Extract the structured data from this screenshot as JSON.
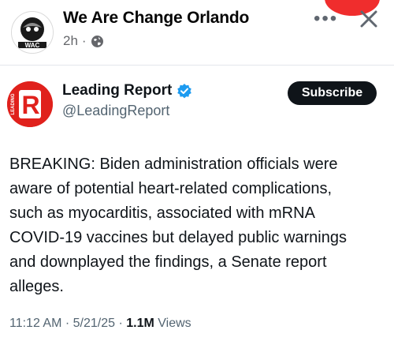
{
  "facebook_post": {
    "page_name": "We Are Change Orlando",
    "time_ago": "2h",
    "separator": "·",
    "more_icon": "more-options-icon",
    "close_icon": "close-icon",
    "privacy_icon": "globe-icon",
    "avatar_text": "WAC"
  },
  "tweet": {
    "author_name": "Leading Report",
    "handle": "@LeadingReport",
    "verified_icon": "verified-badge-icon",
    "avatar_letter": "R",
    "avatar_text": "LEADING",
    "subscribe_label": "Subscribe",
    "body_lines": [
      "BREAKING: Biden administration officials were",
      "aware of potential heart-related complications,",
      "such as myocarditis, associated with mRNA",
      "COVID-19 vaccines but delayed public warnings",
      "and downplayed the findings, a Senate report",
      "alleges."
    ],
    "timestamp": "11:12 AM · 5/21/25 · ",
    "views_count": "1.1M",
    "views_label": "Views"
  },
  "colors": {
    "tweet_avatar_red": "#e0211c",
    "verified_blue": "#1d9bf0",
    "notification_red": "#f02d2d",
    "subscribe_bg": "#0f1419"
  }
}
